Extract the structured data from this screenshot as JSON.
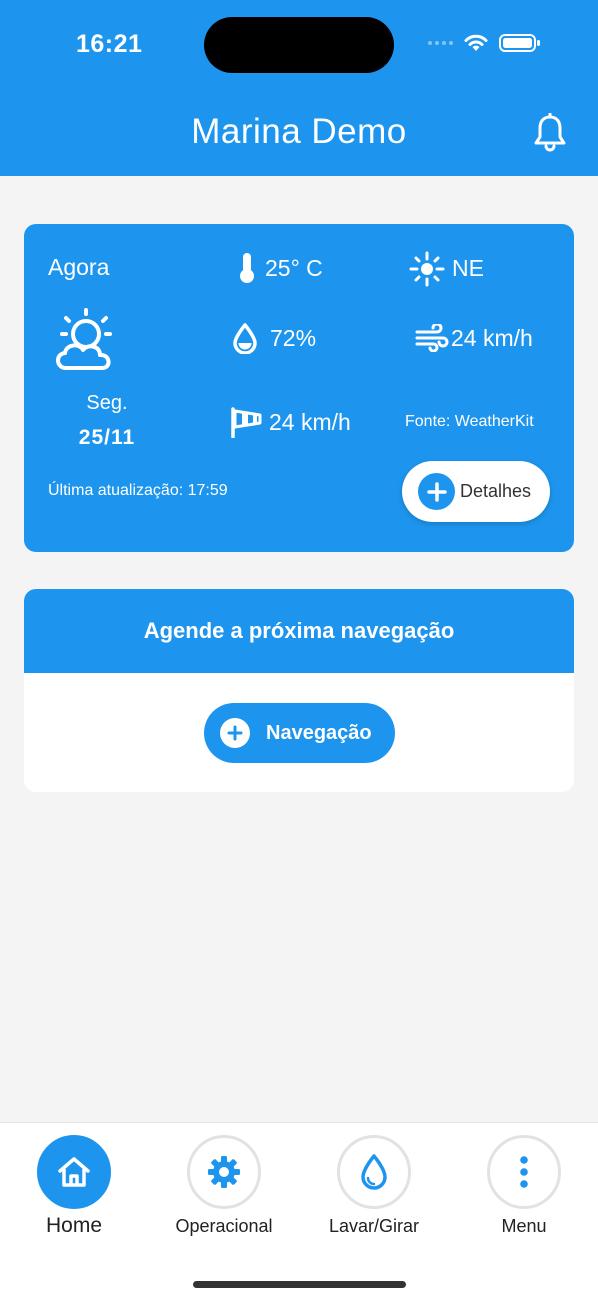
{
  "status_bar": {
    "time": "16:21"
  },
  "header": {
    "title": "Marina Demo",
    "bell_icon": "bell-icon"
  },
  "weather": {
    "now_label": "Agora",
    "day": "Seg.",
    "date": "25/11",
    "temperature": "25° C",
    "wind_direction": "NE",
    "humidity": "72%",
    "wind_speed": "24 km/h",
    "gust_speed": "24 km/h",
    "source": "Fonte: WeatherKit",
    "last_updated": "Última atualização: 17:59",
    "details_label": "Detalhes",
    "icons": [
      "partly-cloudy-icon",
      "thermometer-icon",
      "compass-icon",
      "drop-icon",
      "wind-icon",
      "windsock-icon",
      "plus-icon"
    ]
  },
  "schedule": {
    "title": "Agende a próxima navegação",
    "button_label": "Navegação"
  },
  "tabs": [
    {
      "label": "Home",
      "icon": "home-icon",
      "active": true
    },
    {
      "label": "Operacional",
      "icon": "gear-icon",
      "active": false
    },
    {
      "label": "Lavar/Girar",
      "icon": "water-drop-icon",
      "active": false
    },
    {
      "label": "Menu",
      "icon": "more-vertical-icon",
      "active": false
    }
  ],
  "colors": {
    "primary": "#1d95ee",
    "background": "#f4f4f4"
  }
}
